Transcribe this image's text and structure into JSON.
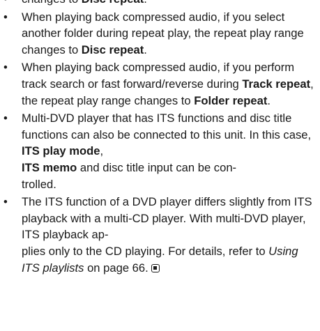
{
  "bullet_glyph": "•",
  "items": [
    {
      "parts": [
        {
          "t": "changes to "
        },
        {
          "t": "Disc repeat",
          "b": true
        },
        {
          "t": "."
        }
      ]
    },
    {
      "parts": [
        {
          "t": "When playing back compressed audio, if you select another folder during repeat play, the repeat play range changes to "
        },
        {
          "t": "Disc repeat",
          "b": true
        },
        {
          "t": "."
        }
      ]
    },
    {
      "parts": [
        {
          "t": "When playing back compressed audio, if you perform track search or fast forward/reverse during "
        },
        {
          "t": "Track repeat",
          "b": true
        },
        {
          "t": ", the repeat play range changes to "
        },
        {
          "t": "Folder repeat",
          "b": true
        },
        {
          "t": "."
        }
      ]
    },
    {
      "parts": [
        {
          "t": "Multi-DVD player that has ITS functions and disc title functions can also be connected to this unit. In this case, "
        },
        {
          "t": "ITS play mode",
          "b": true
        },
        {
          "t": ", "
        },
        {
          "br": true
        },
        {
          "t": "ITS memo",
          "b": true
        },
        {
          "t": " and disc title input can be con-"
        },
        {
          "br": true
        },
        {
          "t": "trolled."
        }
      ]
    },
    {
      "parts": [
        {
          "t": "The ITS function of a DVD player differs slightly from ITS playback with a multi-CD player. With multi-DVD player, ITS playback ap-"
        },
        {
          "br": true
        },
        {
          "t": "plies only to the CD playing. For details, refer to "
        },
        {
          "t": "Using ITS playlists",
          "i": true
        },
        {
          "t": " on page 66."
        }
      ],
      "end_mark": "end-of-section-icon"
    }
  ]
}
